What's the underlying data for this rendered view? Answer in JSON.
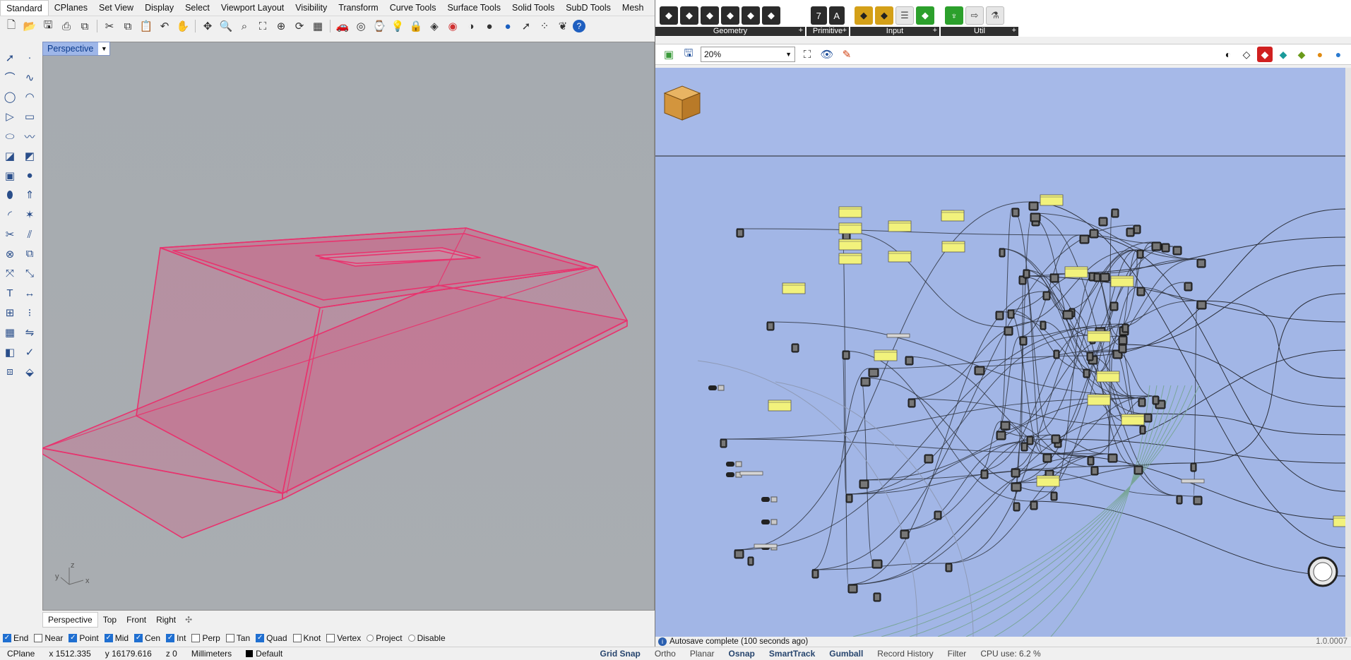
{
  "rhino": {
    "menu_tabs": [
      "Standard",
      "CPlanes",
      "Set View",
      "Display",
      "Select",
      "Viewport Layout",
      "Visibility",
      "Transform",
      "Curve Tools",
      "Surface Tools",
      "Solid Tools",
      "SubD Tools",
      "Mesh"
    ],
    "active_menu_tab": "Standard",
    "toolbar_icons": [
      "new-file-icon",
      "open-folder-icon",
      "save-icon",
      "print-icon",
      "import-icon",
      "cut-icon",
      "copy-icon",
      "paste-icon",
      "undo-icon",
      "pan-hand-icon",
      "rotate-view-icon",
      "zoom-icon",
      "zoom-window-icon",
      "zoom-extents-icon",
      "zoom-selected-icon",
      "rotate-icon",
      "grid-icon",
      "car-icon",
      "named-view-icon",
      "camera-icon",
      "light-icon",
      "lock-icon",
      "layers-icon",
      "color-wheel-icon",
      "shade-icon",
      "render-icon",
      "sphere-icon",
      "select-icon",
      "points-icon",
      "grasshopper-icon",
      "help-icon"
    ],
    "viewport_title": "Perspective",
    "viewport_tabs": [
      "Perspective",
      "Top",
      "Front",
      "Right"
    ],
    "active_viewport_tab": "Perspective",
    "axis_labels": {
      "x": "x",
      "y": "y",
      "z": "z"
    },
    "osnaps": [
      {
        "label": "End",
        "checked": true
      },
      {
        "label": "Near",
        "checked": false
      },
      {
        "label": "Point",
        "checked": true
      },
      {
        "label": "Mid",
        "checked": true
      },
      {
        "label": "Cen",
        "checked": true
      },
      {
        "label": "Int",
        "checked": true
      },
      {
        "label": "Perp",
        "checked": false
      },
      {
        "label": "Tan",
        "checked": false
      },
      {
        "label": "Quad",
        "checked": true
      },
      {
        "label": "Knot",
        "checked": false
      },
      {
        "label": "Vertex",
        "checked": false
      },
      {
        "label": "Project",
        "radio": true
      },
      {
        "label": "Disable",
        "radio": true
      }
    ],
    "model_color": "#e8336e"
  },
  "status_bar": {
    "cplane": "CPlane",
    "x": "x 1512.335",
    "y": "y 16179.616",
    "z": "z 0",
    "units": "Millimeters",
    "layer": "Default",
    "toggles": [
      "Grid Snap",
      "Ortho",
      "Planar",
      "Osnap",
      "SmartTrack",
      "Gumball",
      "Record History",
      "Filter",
      "CPU use: 6.2 %"
    ]
  },
  "grasshopper": {
    "ribbon_panels": [
      {
        "label": "Geometry",
        "icons": [
          "curve-param-icon",
          "surface-param-icon",
          "brep-param-icon",
          "mesh-param-icon",
          "box-param-icon",
          "geometry-icon"
        ]
      },
      {
        "label": "Primitive",
        "icons": [
          "integer-icon",
          "text-icon"
        ]
      },
      {
        "label": "Input",
        "icons": [
          "slider-icon",
          "toggle-icon",
          "list-icon",
          "image-sampler-icon"
        ]
      },
      {
        "label": "Util",
        "icons": [
          "tree-icon",
          "arrow-icon",
          "flask-icon"
        ]
      }
    ],
    "zoom": "20%",
    "status_message": "Autosave complete (100 seconds ago)",
    "version": "1.0.0007",
    "canvas_color": "#a2b6e6",
    "param_color": "#f2f27c"
  }
}
